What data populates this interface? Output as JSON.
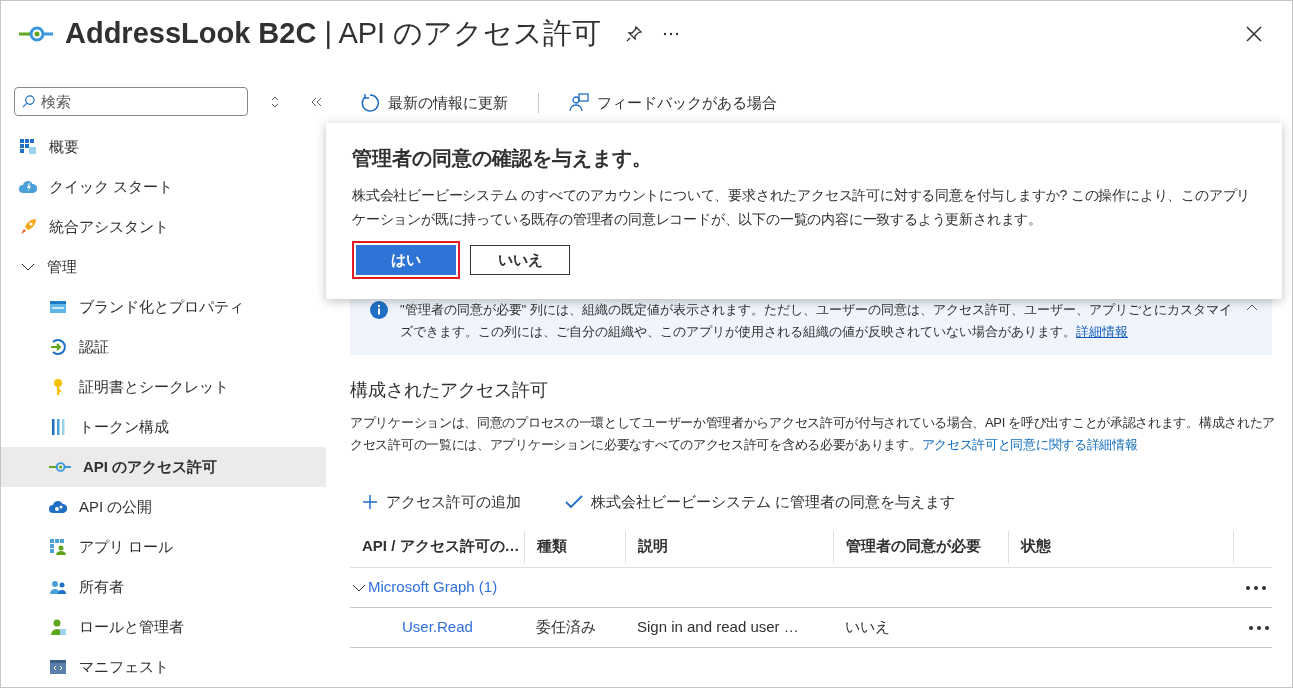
{
  "header": {
    "title": "**AddressLook B2C** | API のアクセス許可"
  },
  "sidebar": {
    "search": {
      "placeholder": "検索"
    },
    "items": [
      {
        "label": "概要",
        "selected": false
      },
      {
        "label": "クイック スタート",
        "selected": false
      },
      {
        "label": "統合アシスタント",
        "selected": false
      },
      {
        "label": "管理",
        "expanded": true,
        "selected": false,
        "children": [
          {
            "label": "ブランド化とプロパティ",
            "selected": false
          },
          {
            "label": "認証",
            "selected": false
          },
          {
            "label": "証明書とシークレット",
            "selected": false
          },
          {
            "label": "トークン構成",
            "selected": false
          },
          {
            "label": "API のアクセス許可",
            "selected": true
          },
          {
            "label": "API の公開",
            "selected": false
          },
          {
            "label": "アプリ ロール",
            "selected": false
          },
          {
            "label": "所有者",
            "selected": false
          },
          {
            "label": "ロールと管理者",
            "selected": false
          },
          {
            "label": "マニフェスト",
            "selected": false
          }
        ]
      }
    ]
  },
  "toolbar": [
    {
      "label": "最新の情報に更新"
    },
    {
      "label": "フィードバックがある場合"
    }
  ],
  "dialog": {
    "title": "管理者の同意の確認を与えます。",
    "message": "株式会社ビービーシステム のすべてのアカウントについて、要求されたアクセス許可に対する同意を付与しますか? この操作により、このアプリケーションが既に持っている既存の管理者の同意レコードが、以下の一覧の内容に一致するよう更新されます。",
    "buttons": [
      {
        "label": "はい",
        "kind": "primary",
        "focused": true
      },
      {
        "label": "いいえ",
        "kind": "secondary",
        "focused": false
      }
    ]
  },
  "info_banner": {
    "text": "\"管理者の同意が必要\" 列には、組織の既定値が表示されます。ただし、ユーザーの同意は、アクセス許可、ユーザー、アプリごとにカスタマイズできます。この列には、ご自分の組織や、このアプリが使用される組織の値が反映されていない場合があります。",
    "link": "詳細情報"
  },
  "section": {
    "heading": "構成されたアクセス許可",
    "description": "アプリケーションは、同意のプロセスの一環としてユーザーか管理者からアクセス許可が付与されている場合、API を呼び出すことが承認されます。構成されたアクセス許可の一覧には、アプリケーションに必要なすべてのアクセス許可を含める必要があります。",
    "link": "アクセス許可と同意に関する詳細情報"
  },
  "commands": [
    {
      "label": "アクセス許可の追加",
      "kind": "add"
    },
    {
      "label": "株式会社ビービーシステム に管理者の同意を与えます",
      "kind": "consent"
    }
  ],
  "table": {
    "columns": [
      "API / アクセス許可の…",
      "種類",
      "説明",
      "管理者の同意が必要",
      "状態"
    ],
    "groups": [
      {
        "name": "Microsoft Graph (1)",
        "expanded": true,
        "rows": [
          [
            "User.Read",
            "委任済み",
            "Sign in and read user …",
            "いいえ",
            ""
          ]
        ]
      }
    ]
  }
}
